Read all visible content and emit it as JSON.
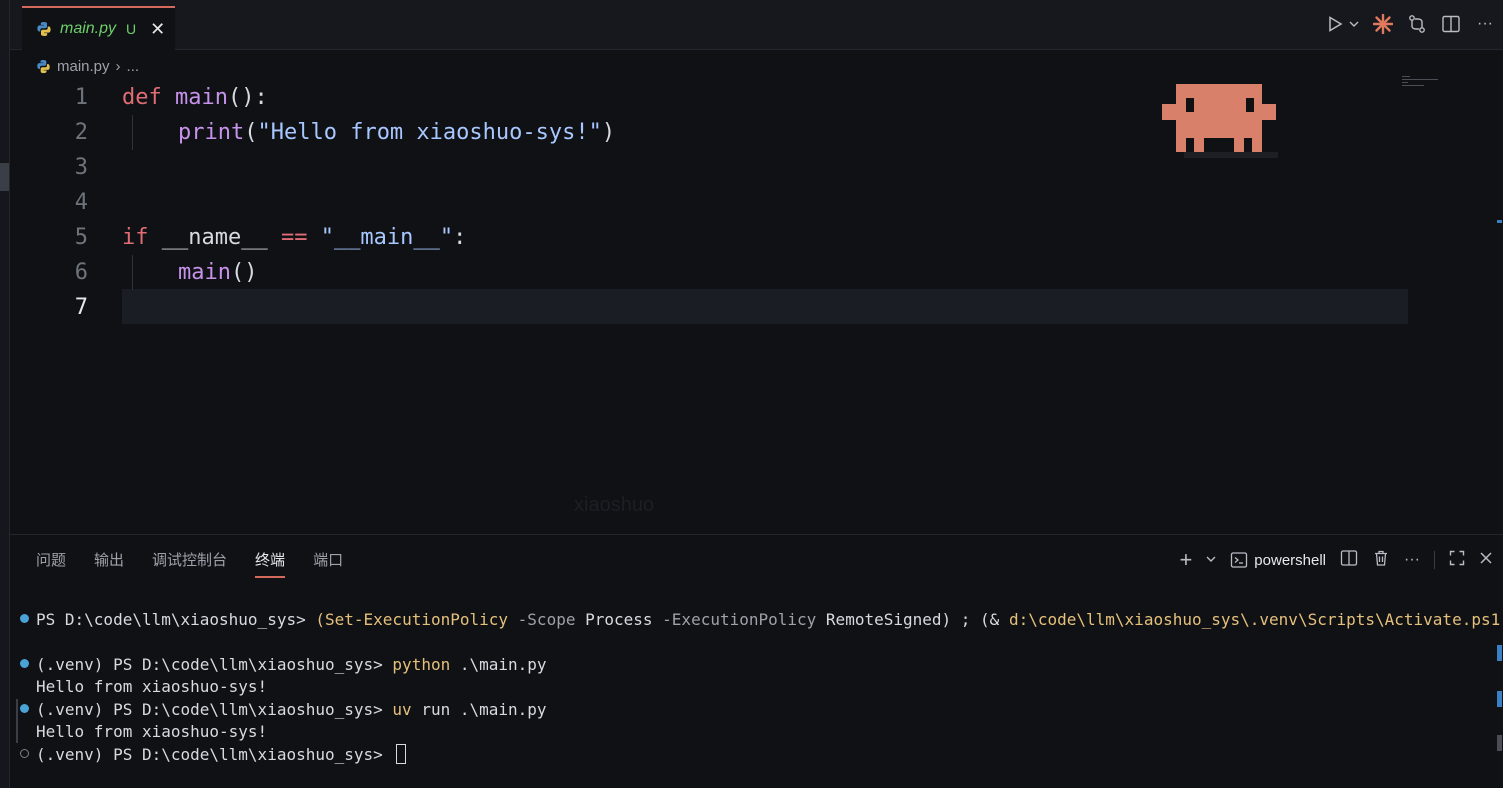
{
  "tab": {
    "name": "main.py",
    "status": "U",
    "close": "✕"
  },
  "breadcrumb": {
    "file": "main.py",
    "sep": "›",
    "more": "..."
  },
  "editor": {
    "lines": [
      {
        "no": "1"
      },
      {
        "no": "2"
      },
      {
        "no": "3"
      },
      {
        "no": "4"
      },
      {
        "no": "5"
      },
      {
        "no": "6"
      },
      {
        "no": "7"
      }
    ],
    "code": {
      "l1_kw": "def",
      "l1_fn": "main",
      "l1_rest": "():",
      "l2_fn": "print",
      "l2_open": "(",
      "l2_str": "\"Hello from xiaoshuo-sys!\"",
      "l2_close": ")",
      "l5_kw": "if",
      "l5_name": " __name__ ",
      "l5_op": "==",
      "l5_str": " \"__main__\"",
      "l5_colon": ":",
      "l6_fn": "main",
      "l6_rest": "()"
    },
    "watermark": "xiaoshuo"
  },
  "panel": {
    "tabs": [
      "问题",
      "输出",
      "调试控制台",
      "终端",
      "端口"
    ],
    "active_tab": "终端",
    "shell": "powershell",
    "add": "+"
  },
  "terminal": {
    "l1_prompt": "PS D:\\code\\llm\\xiaoshuo_sys> ",
    "l1_a": "(",
    "l1_cmd1": "Set-ExecutionPolicy",
    "l1_p1": " -Scope ",
    "l1_v1": "Process",
    "l1_p2": " -ExecutionPolicy ",
    "l1_v2": "RemoteSigned",
    "l1_b": ") ; (& ",
    "l1_path": "d:\\code\\llm\\xiaoshuo_sys\\.venv\\Scripts\\Activate.ps1",
    "l1_c": ")",
    "l2_prompt": "(.venv) PS D:\\code\\llm\\xiaoshuo_sys> ",
    "l2_cmd": "python",
    "l2_arg": " .\\main.py",
    "l3": "Hello from xiaoshuo-sys!",
    "l4_prompt": "(.venv) PS D:\\code\\llm\\xiaoshuo_sys> ",
    "l4_cmd": "uv",
    "l4_arg": " run .\\main.py",
    "l5": "Hello from xiaoshuo-sys!",
    "l6_prompt": "(.venv) PS D:\\code\\llm\\xiaoshuo_sys> "
  },
  "colors": {
    "accent": "#d36a5b",
    "modified": "#6ecf6a",
    "keyword": "#e06c75",
    "function": "#c792ea",
    "string": "#a9c7ff",
    "terminal_cmd": "#e5c07b",
    "dot": "#4aa3d6"
  },
  "icons": [
    "python-file-icon",
    "run-icon",
    "chevron-down-icon",
    "claude-sparkle-icon",
    "compare-changes-icon",
    "split-editor-icon",
    "more-icon",
    "terminal-icon",
    "trash-icon",
    "maximize-icon",
    "close-icon"
  ]
}
